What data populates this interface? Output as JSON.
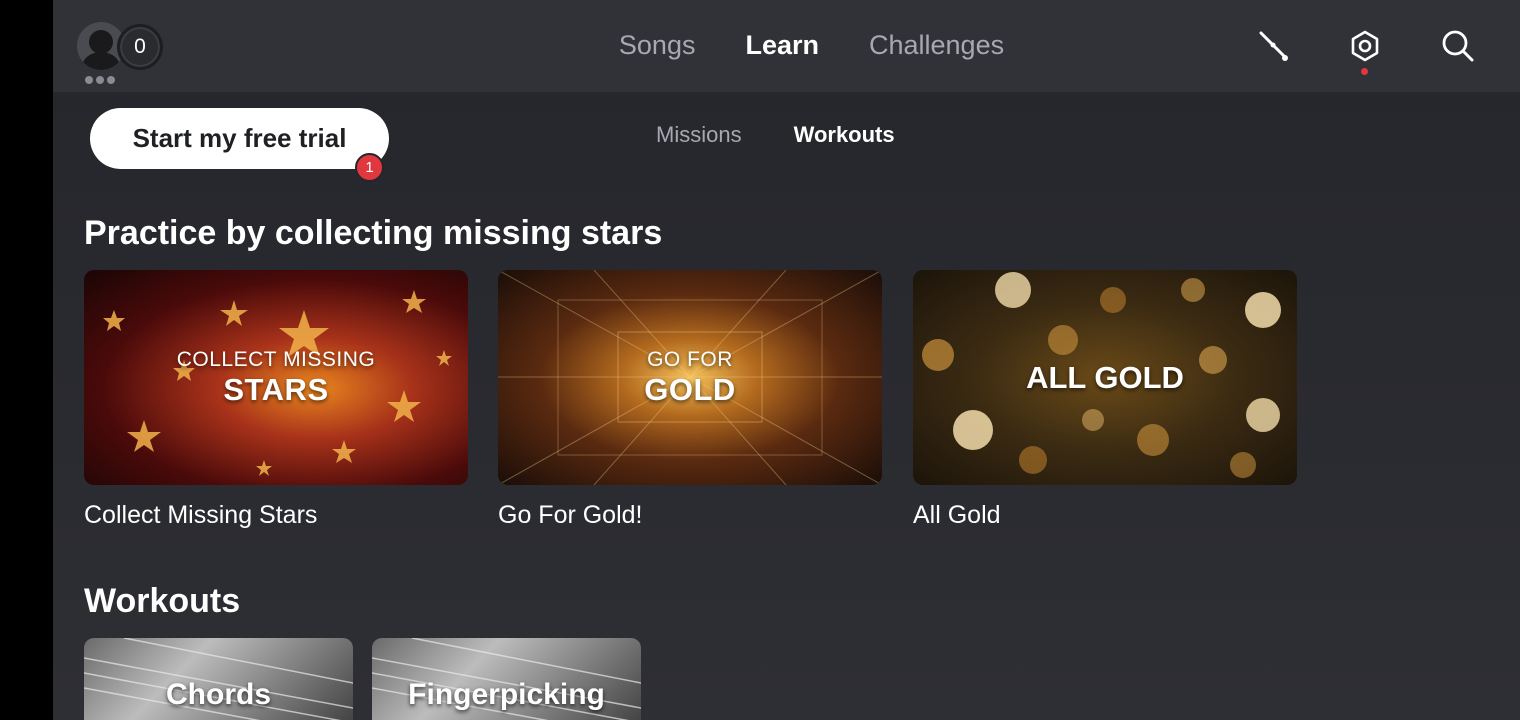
{
  "header": {
    "level": "0",
    "nav": [
      {
        "label": "Songs",
        "active": false
      },
      {
        "label": "Learn",
        "active": true
      },
      {
        "label": "Challenges",
        "active": false
      }
    ],
    "icons": [
      "tuner-icon",
      "settings-icon",
      "search-icon"
    ]
  },
  "subheader": {
    "trial_label": "Start my free trial",
    "trial_badge": "1",
    "tabs": [
      {
        "label": "Missions",
        "active": false
      },
      {
        "label": "Workouts",
        "active": true
      }
    ]
  },
  "stars_section": {
    "title": "Practice by collecting missing stars",
    "cards": [
      {
        "label": "Collect Missing Stars",
        "art_small": "COLLECT MISSING",
        "art_big": "STARS"
      },
      {
        "label": "Go For Gold!",
        "art_small": "GO FOR",
        "art_big": "GOLD"
      },
      {
        "label": "All Gold",
        "art_small": "",
        "art_big": "ALL GOLD"
      }
    ]
  },
  "workouts_section": {
    "title": "Workouts",
    "cards": [
      {
        "label": "Chords"
      },
      {
        "label": "Fingerpicking"
      }
    ]
  },
  "colors": {
    "background": "#25262b",
    "topbar": "#313237",
    "accent_red": "#e0383e",
    "muted_text": "#a7a9b0"
  }
}
